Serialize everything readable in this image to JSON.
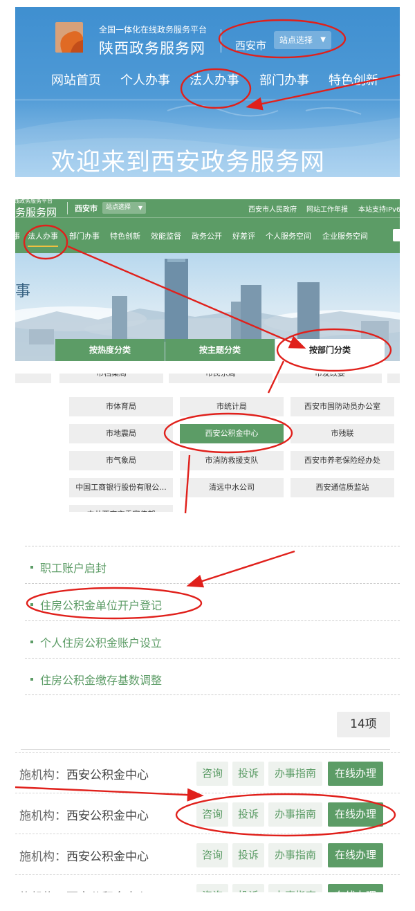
{
  "colors": {
    "brand_green": "#5c9c66",
    "banner_blue": "#4f9ad6",
    "annotation_red": "#e0201b",
    "button_light": "#eef2ee"
  },
  "panel1": {
    "slogan": "全国一体化在线政务服务平台",
    "site_name": "陕西政务服务网",
    "city": "西安市",
    "station_select": "站点选择",
    "nav": [
      "网站首页",
      "个人办事",
      "法人办事",
      "部门办事",
      "特色创新"
    ],
    "welcome": "欢迎来到西安政务服务网"
  },
  "panel2": {
    "slogan_fragment": "线政务服务平台",
    "site_fragment": "务服务网",
    "city": "西安市",
    "station_select": "站点选择",
    "top_links": [
      "西安市人民政府",
      "网站工作年报",
      "本站支持IPv6"
    ],
    "nav": [
      "事",
      "法人办事",
      "部门办事",
      "特色创新",
      "效能监督",
      "政务公开",
      "好差评",
      "个人服务空间",
      "企业服务空间"
    ],
    "tabs": [
      "按热度分类",
      "按主题分类",
      "按部门分类"
    ]
  },
  "panel3": {
    "top_row": [
      "",
      "市档案局",
      "市民宗局",
      "市发改委",
      ""
    ],
    "rows": [
      [
        "市体育局",
        "市统计局",
        "西安市国防动员办公室"
      ],
      [
        "市地震局",
        "西安公积金中心",
        "市残联"
      ],
      [
        "市气象局",
        "市消防救援支队",
        "西安市养老保险经办处"
      ],
      [
        "中国工商银行股份有限公...",
        "清远中水公司",
        "西安通信质监站"
      ]
    ],
    "partial_last": "中共西安市委宣传部"
  },
  "panel4": {
    "services": [
      "职工账户启封",
      "住房公积金单位开户登记",
      "个人住房公积金账户设立",
      "住房公积金缴存基数调整"
    ]
  },
  "panel5": {
    "count": "14项",
    "org_label": "施机构：",
    "org_name": "西安公积金中心",
    "buttons": [
      "咨询",
      "投诉",
      "办事指南",
      "在线办理"
    ]
  }
}
